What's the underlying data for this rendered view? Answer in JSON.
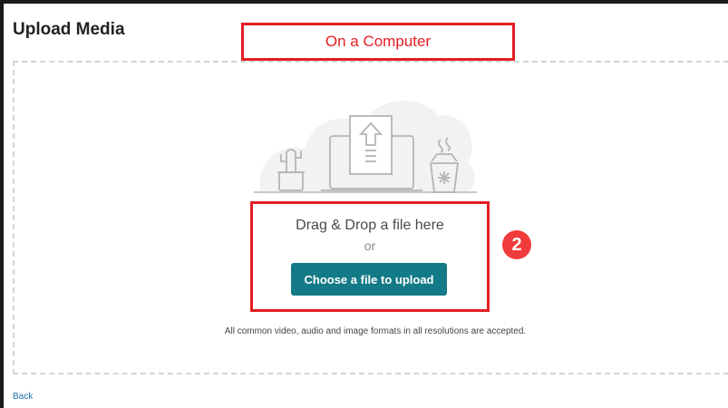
{
  "page": {
    "title": "Upload Media"
  },
  "annotations": {
    "computer_label": "On a Computer",
    "step_number": "2",
    "highlight_color": "#e31e24",
    "badge_color": "#ef3b3b"
  },
  "dropzone": {
    "drag_text": "Drag & Drop a file here",
    "or_text": "or",
    "choose_button_label": "Choose a file to upload",
    "button_color": "#137a87",
    "formats_note": "All common video, audio and image formats in all resolutions are accepted.",
    "illustration_icons": [
      "cactus-icon",
      "laptop-upload-icon",
      "coffee-cup-icon"
    ]
  },
  "footer": {
    "back_label": "Back"
  }
}
